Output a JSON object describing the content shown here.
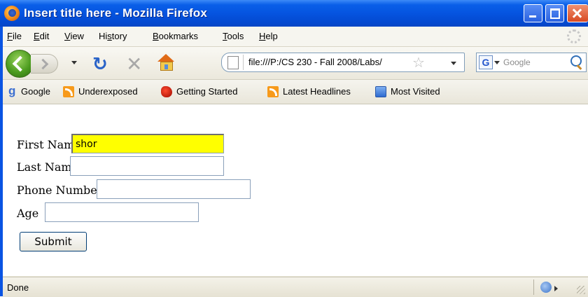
{
  "window": {
    "title": "Insert title here - Mozilla Firefox",
    "controls": {
      "minimize": "minimize",
      "maximize": "maximize",
      "close": "close"
    }
  },
  "menubar": {
    "items": [
      {
        "label": "File",
        "accel": "F",
        "rest": "ile"
      },
      {
        "label": "Edit",
        "accel": "E",
        "rest": "dit"
      },
      {
        "label": "View",
        "accel": "V",
        "rest": "iew"
      },
      {
        "label": "History",
        "accel": "s",
        "pre": "Hi",
        "rest": "tory"
      },
      {
        "label": "Bookmarks",
        "accel": "B",
        "rest": "ookmarks"
      },
      {
        "label": "Tools",
        "accel": "T",
        "rest": "ools"
      },
      {
        "label": "Help",
        "accel": "H",
        "rest": "elp"
      }
    ]
  },
  "navbar": {
    "url": "file:///P:/CS 230 - Fall 2008/Labs/",
    "search_placeholder": "Google",
    "icons": [
      "back-icon",
      "forward-icon",
      "reload-icon",
      "stop-icon",
      "home-icon",
      "page-icon",
      "star-icon",
      "google-icon",
      "search-icon"
    ]
  },
  "bookmarks": {
    "items": [
      {
        "label": "Google",
        "icon": "google-icon"
      },
      {
        "label": "Underexposed",
        "icon": "rss-icon"
      },
      {
        "label": "Getting Started",
        "icon": "firefox-icon"
      },
      {
        "label": "Latest Headlines",
        "icon": "rss-icon"
      },
      {
        "label": "Most Visited",
        "icon": "folder-icon"
      }
    ]
  },
  "form": {
    "first_name_label": "First Name",
    "first_name_value": "shor",
    "last_name_label": "Last Name",
    "last_name_value": "",
    "phone_label": "Phone Number",
    "phone_value": "",
    "age_label": "Age",
    "age_value": "",
    "submit_label": "Submit"
  },
  "status": {
    "text": "Done"
  },
  "colors": {
    "titlebar": "#0a5fe8",
    "highlight_input": "#ffff00"
  }
}
